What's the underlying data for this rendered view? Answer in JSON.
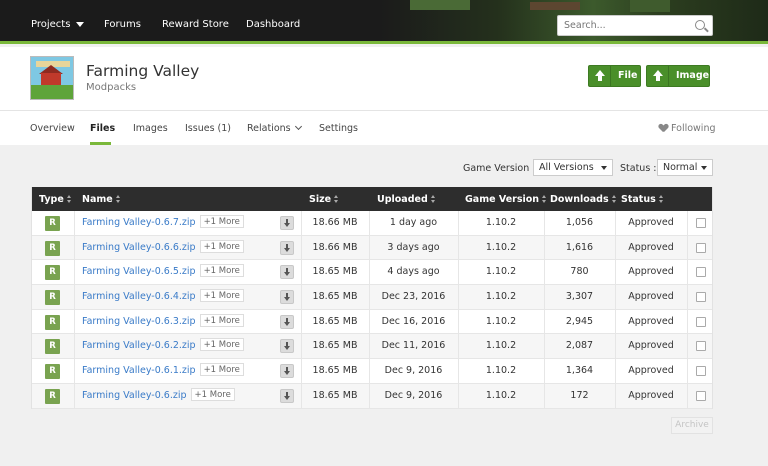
{
  "nav": {
    "projects": "Projects",
    "forums": "Forums",
    "reward_store": "Reward Store",
    "dashboard": "Dashboard",
    "search_placeholder": "Search..."
  },
  "project": {
    "title": "Farming Valley",
    "category": "Modpacks",
    "file_button": "File",
    "image_button": "Image",
    "following": "Following"
  },
  "tabs": [
    "Overview",
    "Files",
    "Images",
    "Issues (1)",
    "Relations",
    "Settings"
  ],
  "filters": {
    "game_version_label": "Game Version :",
    "game_version_value": "All Versions",
    "status_label": "Status :",
    "status_value": "Normal"
  },
  "table": {
    "headers": [
      "Type",
      "Name",
      "Size",
      "Uploaded",
      "Game Version",
      "Downloads",
      "Status"
    ],
    "rows": [
      {
        "type": "R",
        "name": "Farming Valley-0.6.7.zip",
        "more": "+1 More",
        "size": "18.66 MB",
        "uploaded": "1 day ago",
        "game_version": "1.10.2",
        "downloads": "1,056",
        "status": "Approved"
      },
      {
        "type": "R",
        "name": "Farming Valley-0.6.6.zip",
        "more": "+1 More",
        "size": "18.66 MB",
        "uploaded": "3 days ago",
        "game_version": "1.10.2",
        "downloads": "1,616",
        "status": "Approved"
      },
      {
        "type": "R",
        "name": "Farming Valley-0.6.5.zip",
        "more": "+1 More",
        "size": "18.65 MB",
        "uploaded": "4 days ago",
        "game_version": "1.10.2",
        "downloads": "780",
        "status": "Approved"
      },
      {
        "type": "R",
        "name": "Farming Valley-0.6.4.zip",
        "more": "+1 More",
        "size": "18.65 MB",
        "uploaded": "Dec 23, 2016",
        "game_version": "1.10.2",
        "downloads": "3,307",
        "status": "Approved"
      },
      {
        "type": "R",
        "name": "Farming Valley-0.6.3.zip",
        "more": "+1 More",
        "size": "18.65 MB",
        "uploaded": "Dec 16, 2016",
        "game_version": "1.10.2",
        "downloads": "2,945",
        "status": "Approved"
      },
      {
        "type": "R",
        "name": "Farming Valley-0.6.2.zip",
        "more": "+1 More",
        "size": "18.65 MB",
        "uploaded": "Dec 11, 2016",
        "game_version": "1.10.2",
        "downloads": "2,087",
        "status": "Approved"
      },
      {
        "type": "R",
        "name": "Farming Valley-0.6.1.zip",
        "more": "+1 More",
        "size": "18.65 MB",
        "uploaded": "Dec 9, 2016",
        "game_version": "1.10.2",
        "downloads": "1,364",
        "status": "Approved"
      },
      {
        "type": "R",
        "name": "Farming Valley-0.6.zip",
        "more": "+1 More",
        "size": "18.65 MB",
        "uploaded": "Dec 9, 2016",
        "game_version": "1.10.2",
        "downloads": "172",
        "status": "Approved"
      }
    ]
  },
  "archive_button": "Archive",
  "colors": {
    "accent_green": "#7ab83a",
    "button_green": "#4a8f2a",
    "link_blue": "#3a7bc8",
    "header_dark": "#1b1b1b",
    "type_badge": "#79a350"
  }
}
